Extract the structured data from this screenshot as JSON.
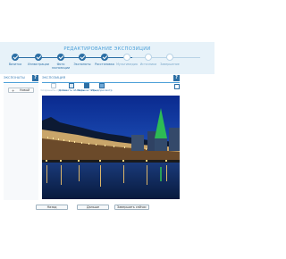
{
  "header": {
    "title": "РЕДАКТИРОВАНИЕ ЭКСПОЗИЦИИ"
  },
  "steps": [
    {
      "label": "Визитка",
      "state": "done"
    },
    {
      "label": "Иллюстрации",
      "state": "done"
    },
    {
      "label": "Фото экспозиции",
      "state": "done"
    },
    {
      "label": "Экспонаты",
      "state": "done"
    },
    {
      "label": "Расстановка",
      "state": "done"
    },
    {
      "label": "Мультимедиа",
      "state": "pending"
    },
    {
      "label": "Источники",
      "state": "pending"
    },
    {
      "label": "Завершение",
      "state": "pending"
    }
  ],
  "panels": {
    "exhibits": {
      "title": "ЭКСПОНАТЫ",
      "help": "?",
      "add_button": "Новый",
      "add_icon": "+"
    },
    "exposition": {
      "title": "ЭКСПОЗИЦИЯ",
      "help": "?"
    }
  },
  "toolbar": {
    "items": [
      {
        "label": "Сохранить статью",
        "icon": "save-icon",
        "disabled": true
      },
      {
        "label": "Добавить область",
        "icon": "add-area-icon",
        "disabled": false
      },
      {
        "label": "Переместить",
        "icon": "move-icon",
        "disabled": false
      },
      {
        "label": "Предпросмотр",
        "icon": "preview-icon",
        "disabled": false
      }
    ],
    "expand_icon": "expand-icon"
  },
  "photo": {
    "subject": "night-city-waterfront"
  },
  "footer": {
    "back": "Назад",
    "next": "Дальше",
    "finish": "Завершить сейчас"
  },
  "colors": {
    "accent": "#2c6fa5",
    "accent_light": "#4a9fd8",
    "band": "#e7f2f9"
  }
}
